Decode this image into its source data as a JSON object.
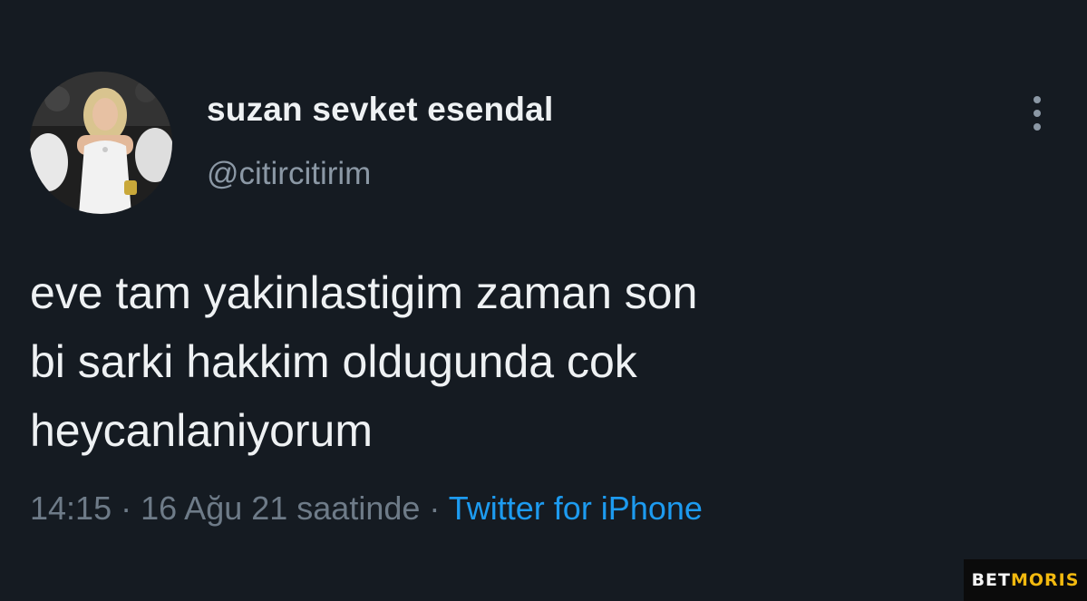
{
  "user": {
    "display_name": "suzan sevket esendal",
    "handle": "@citircitirim",
    "avatar_icon": "user-photo"
  },
  "tweet": {
    "lines": [
      "eve tam yakinlastigim zaman son",
      "bi sarki hakkim oldugunda cok",
      "heycanlaniyorum"
    ],
    "time": "14:15",
    "separator": "·",
    "date": "16 Ağu 21 saatinde",
    "source": "Twitter for iPhone"
  },
  "menu": {
    "icon": "more-vertical-icon"
  },
  "watermark": {
    "part1": "BET",
    "part2": "MORIS"
  },
  "colors": {
    "background": "#151b22",
    "text": "#eef1f3",
    "secondary": "#8b98a5",
    "link": "#1d9bf0",
    "watermark_accent": "#f2b90f"
  }
}
